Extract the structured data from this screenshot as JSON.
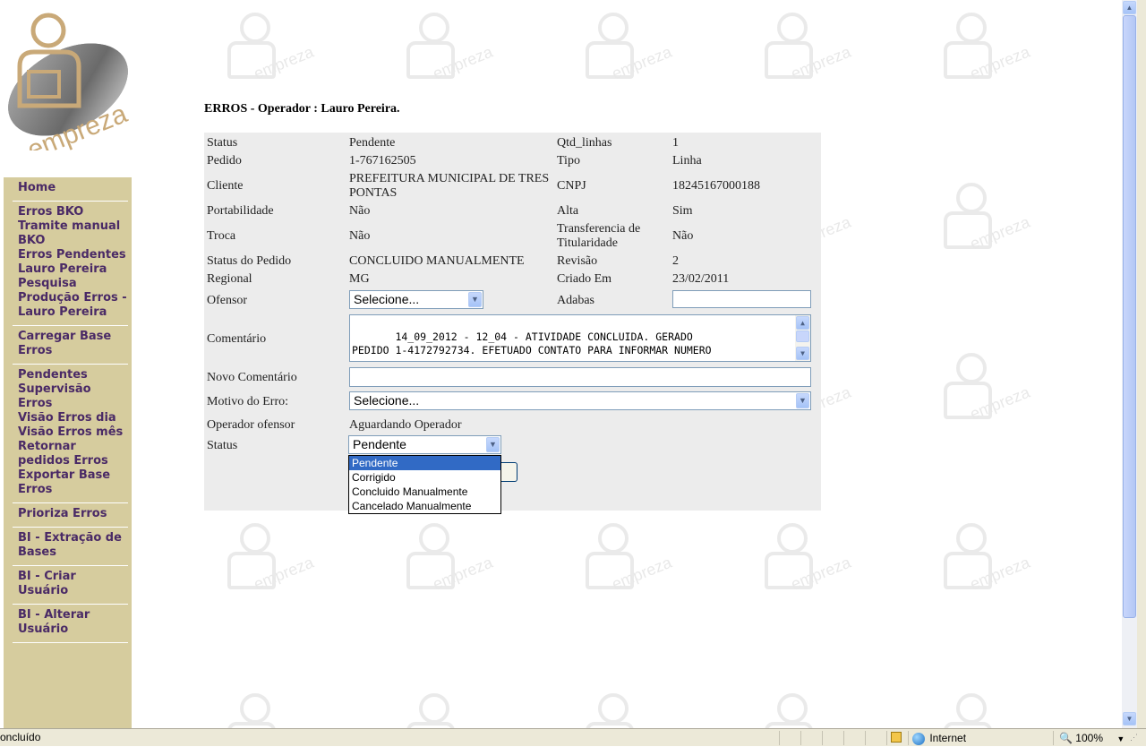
{
  "app": {
    "logo_text": "empreza",
    "watermark_text": "empreza"
  },
  "sidebar": {
    "groups": [
      [
        "Home"
      ],
      [
        "Erros BKO",
        "Tramite manual BKO",
        "Erros Pendentes Lauro Pereira",
        "Pesquisa Produção Erros - Lauro Pereira"
      ],
      [
        "Carregar Base Erros"
      ],
      [
        "Pendentes Supervisão Erros",
        "Visão Erros dia",
        "Visão Erros mês",
        "Retornar pedidos Erros",
        "Exportar Base Erros"
      ],
      [
        "Prioriza Erros"
      ],
      [
        "BI - Extração de Bases"
      ],
      [
        "BI - Criar Usuário"
      ],
      [
        "BI - Alterar Usuário"
      ]
    ]
  },
  "page": {
    "title": "ERROS - Operador : Lauro Pereira."
  },
  "form": {
    "status_label": "Status",
    "status_value": "Pendente",
    "qtd_linhas_label": "Qtd_linhas",
    "qtd_linhas_value": "1",
    "pedido_label": "Pedido",
    "pedido_value": "1-767162505",
    "tipo_label": "Tipo",
    "tipo_value": "Linha",
    "cliente_label": "Cliente",
    "cliente_value": "PREFEITURA MUNICIPAL DE TRES PONTAS",
    "cnpj_label": "CNPJ",
    "cnpj_value": "18245167000188",
    "portabilidade_label": "Portabilidade",
    "portabilidade_value": "Não",
    "alta_label": "Alta",
    "alta_value": "Sim",
    "troca_label": "Troca",
    "troca_value": "Não",
    "transferencia_label": "Transferencia de Titularidade",
    "transferencia_value": "Não",
    "status_pedido_label": "Status do Pedido",
    "status_pedido_value": "CONCLUIDO MANUALMENTE",
    "revisao_label": "Revisão",
    "revisao_value": "2",
    "regional_label": "Regional",
    "regional_value": "MG",
    "criado_em_label": "Criado Em",
    "criado_em_value": "23/02/2011",
    "ofensor_label": "Ofensor",
    "ofensor_selected": "Selecione...",
    "adabas_label": "Adabas",
    "adabas_value": "",
    "comentario_label": "Comentário",
    "comentario_line1": "       14_09_2012 - 12_04 - ATIVIDADE CONCLUIDA. GERADO",
    "comentario_line2": "PEDIDO 1-4172792734. EFETUADO CONTATO PARA INFORMAR NUMERO",
    "novo_comentario_label": "Novo Comentário",
    "novo_comentario_value": "",
    "motivo_label": "Motivo do Erro:",
    "motivo_selected": "Selecione...",
    "operador_ofensor_label": "Operador ofensor",
    "operador_ofensor_value": "Aguardando Operador",
    "status2_label": "Status",
    "status2_selected": "Pendente",
    "status2_options": [
      "Pendente",
      "Corrigido",
      "Concluido Manualmente",
      "Cancelado Manualmente"
    ]
  },
  "statusbar": {
    "left_text": "oncluído",
    "zone": "Internet",
    "zoom": "100%"
  }
}
